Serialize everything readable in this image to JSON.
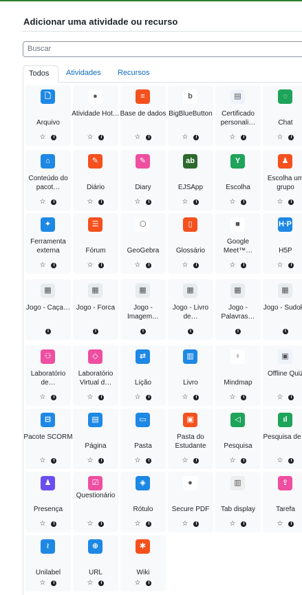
{
  "dialog": {
    "title": "Adicionar uma atividade ou recurso",
    "search_placeholder": "Buscar"
  },
  "tabs": [
    {
      "label": "Todos",
      "active": true
    },
    {
      "label": "Atividades",
      "active": false
    },
    {
      "label": "Recursos",
      "active": false
    }
  ],
  "items": [
    {
      "label": "Arquivo",
      "icon": "file-icon",
      "color": "#1e88e5",
      "glyph": "🗋",
      "star": true
    },
    {
      "label": "Atividade Hot…",
      "icon": "hotpot-icon",
      "color": "#ffffff",
      "glyph": "●",
      "star": true
    },
    {
      "label": "Base de dados",
      "icon": "database-icon",
      "color": "#f4511e",
      "glyph": "≡",
      "star": true
    },
    {
      "label": "BigBlueButton",
      "icon": "bigbluebutton-icon",
      "color": "#ffffff",
      "glyph": "b",
      "star": true
    },
    {
      "label": "Certificado personali…",
      "icon": "certificate-icon",
      "color": "#eef3fb",
      "glyph": "▤",
      "star": true
    },
    {
      "label": "Chat",
      "icon": "chat-icon",
      "color": "#1ea35a",
      "glyph": "◌",
      "star": true
    },
    {
      "label": "Conteúdo do pacot…",
      "icon": "package-content-icon",
      "color": "#1e88e5",
      "glyph": "⌂",
      "star": true
    },
    {
      "label": "Diário",
      "icon": "journal-icon",
      "color": "#f4511e",
      "glyph": "✎",
      "star": true
    },
    {
      "label": "Diary",
      "icon": "diary-icon",
      "color": "#ee4fa0",
      "glyph": "✎",
      "star": true
    },
    {
      "label": "EJSApp",
      "icon": "ejsapp-icon",
      "color": "#2d6a2d",
      "glyph": "ab",
      "star": true
    },
    {
      "label": "Escolha",
      "icon": "choice-icon",
      "color": "#1ea35a",
      "glyph": "Y",
      "star": true
    },
    {
      "label": "Escolha um grupo",
      "icon": "group-choice-icon",
      "color": "#f4511e",
      "glyph": "♟",
      "star": true
    },
    {
      "label": "Ferramenta externa",
      "icon": "puzzle-icon",
      "color": "#1e88e5",
      "glyph": "✦",
      "star": true
    },
    {
      "label": "Fórum",
      "icon": "forum-icon",
      "color": "#f4511e",
      "glyph": "☰",
      "star": true
    },
    {
      "label": "GeoGebra",
      "icon": "geogebra-icon",
      "color": "#ffffff",
      "glyph": "⬡",
      "star": true
    },
    {
      "label": "Glossário",
      "icon": "glossary-icon",
      "color": "#f4511e",
      "glyph": "▯",
      "star": true
    },
    {
      "label": "Google Meet™…",
      "icon": "google-meet-icon",
      "color": "#ffffff",
      "glyph": "■",
      "star": true
    },
    {
      "label": "H5P",
      "icon": "h5p-icon",
      "color": "#1e88e5",
      "glyph": "H·P",
      "star": true
    },
    {
      "label": "Jogo - Caça…",
      "icon": "game-icon",
      "color": "#e7ecef",
      "glyph": "▦",
      "star": false
    },
    {
      "label": "Jogo - Forca",
      "icon": "game-icon",
      "color": "#e7ecef",
      "glyph": "▦",
      "star": false
    },
    {
      "label": "Jogo - Imagem…",
      "icon": "game-icon",
      "color": "#e7ecef",
      "glyph": "▦",
      "star": false
    },
    {
      "label": "Jogo - Livro de…",
      "icon": "game-icon",
      "color": "#e7ecef",
      "glyph": "▦",
      "star": false
    },
    {
      "label": "Jogo - Palavras…",
      "icon": "game-icon",
      "color": "#e7ecef",
      "glyph": "▦",
      "star": false
    },
    {
      "label": "Jogo - Sudoku",
      "icon": "game-icon",
      "color": "#e7ecef",
      "glyph": "▦",
      "star": false
    },
    {
      "label": "Laboratório de…",
      "icon": "workshop-icon",
      "color": "#ee4fa0",
      "glyph": "⚇",
      "star": true
    },
    {
      "label": "Laboratório Virtual d…",
      "icon": "virtual-lab-icon",
      "color": "#ee4fa0",
      "glyph": "◇",
      "star": true
    },
    {
      "label": "Lição",
      "icon": "lesson-icon",
      "color": "#1e88e5",
      "glyph": "⇄",
      "star": true
    },
    {
      "label": "Livro",
      "icon": "book-icon",
      "color": "#1e88e5",
      "glyph": "▥",
      "star": true
    },
    {
      "label": "Mindmap",
      "icon": "lightbulb-icon",
      "color": "#ffffff",
      "glyph": "♀",
      "star": true
    },
    {
      "label": "Offline Quiz",
      "icon": "offline-quiz-icon",
      "color": "#eef3fb",
      "glyph": "▣",
      "star": true
    },
    {
      "label": "Pacote SCORM",
      "icon": "scorm-icon",
      "color": "#1e88e5",
      "glyph": "⊟",
      "star": true
    },
    {
      "label": "Página",
      "icon": "page-icon",
      "color": "#1e88e5",
      "glyph": "▤",
      "star": true
    },
    {
      "label": "Pasta",
      "icon": "folder-icon",
      "color": "#1e88e5",
      "glyph": "▭",
      "star": true
    },
    {
      "label": "Pasta do Estudante",
      "icon": "student-folder-icon",
      "color": "#f4511e",
      "glyph": "▣",
      "star": true
    },
    {
      "label": "Pesquisa",
      "icon": "feedback-icon",
      "color": "#1ea35a",
      "glyph": "◁",
      "star": true
    },
    {
      "label": "Pesquisa de…",
      "icon": "survey-icon",
      "color": "#1ea35a",
      "glyph": "ıl",
      "star": true
    },
    {
      "label": "Presença",
      "icon": "attendance-icon",
      "color": "#6b4ef0",
      "glyph": "♟",
      "star": true
    },
    {
      "label": "Questionário",
      "icon": "quiz-icon",
      "color": "#ee4fa0",
      "glyph": "☑",
      "star": true
    },
    {
      "label": "Rótulo",
      "icon": "label-icon",
      "color": "#1e88e5",
      "glyph": "◈",
      "star": true
    },
    {
      "label": "Secure PDF",
      "icon": "secure-pdf-icon",
      "color": "#ffffff",
      "glyph": "●",
      "star": true
    },
    {
      "label": "Tab display",
      "icon": "tab-display-icon",
      "color": "#eeeeee",
      "glyph": "▥",
      "star": true
    },
    {
      "label": "Tarefa",
      "icon": "assignment-icon",
      "color": "#ee4fa0",
      "glyph": "⇪",
      "star": true
    },
    {
      "label": "Unilabel",
      "icon": "unilabel-icon",
      "color": "#1e88e5",
      "glyph": "≀",
      "star": true
    },
    {
      "label": "URL",
      "icon": "globe-icon",
      "color": "#1e88e5",
      "glyph": "⊕",
      "star": true
    },
    {
      "label": "Wiki",
      "icon": "wiki-icon",
      "color": "#f4511e",
      "glyph": "✱",
      "star": true
    }
  ],
  "controls": {
    "star_glyph": "☆",
    "info_glyph": "i"
  }
}
